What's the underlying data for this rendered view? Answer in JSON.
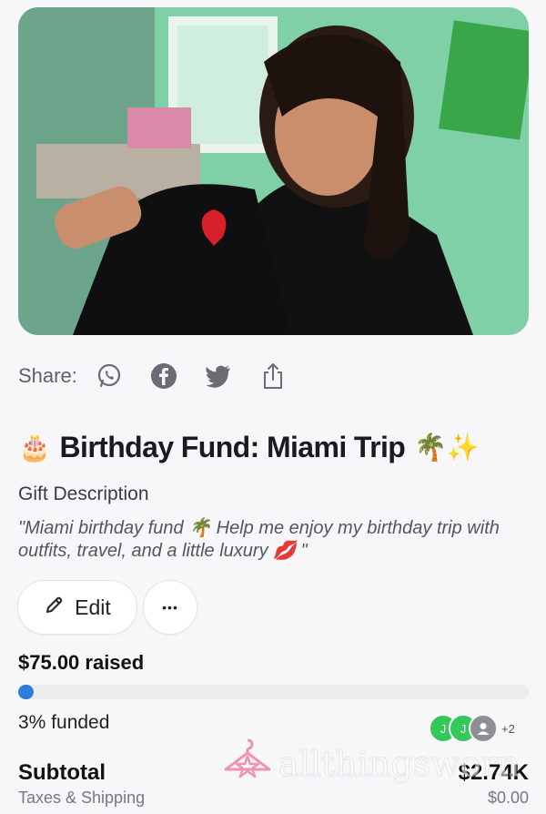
{
  "share": {
    "label": "Share:",
    "icons": [
      "whatsapp-icon",
      "facebook-icon",
      "twitter-icon",
      "share-upload-icon"
    ]
  },
  "gift": {
    "title_emoji_start": "🎂",
    "title": "Birthday Fund: Miami Trip",
    "title_emoji_end": "🌴✨",
    "description_label": "Gift Description",
    "description": "\"Miami birthday fund 🌴 Help me enjoy my birthday trip with outfits, travel, and a little luxury 💋 \""
  },
  "actions": {
    "edit_label": "Edit",
    "more_label": "•••"
  },
  "funding": {
    "raised_text": "$75.00 raised",
    "funded_text": "3% funded",
    "progress_fraction": 0.03,
    "contributors": [
      "J",
      "J"
    ],
    "extra_contributors": "+2"
  },
  "totals": {
    "subtotal_label": "Subtotal",
    "subtotal_value": "$2.74K",
    "taxes_label": "Taxes & Shipping",
    "taxes_value": "$0.00"
  },
  "watermark": {
    "text": "allthingsworn"
  },
  "colors": {
    "accent": "#2e7dd6",
    "contributor": "#34c759",
    "watermark_pink": "#e8457a"
  }
}
